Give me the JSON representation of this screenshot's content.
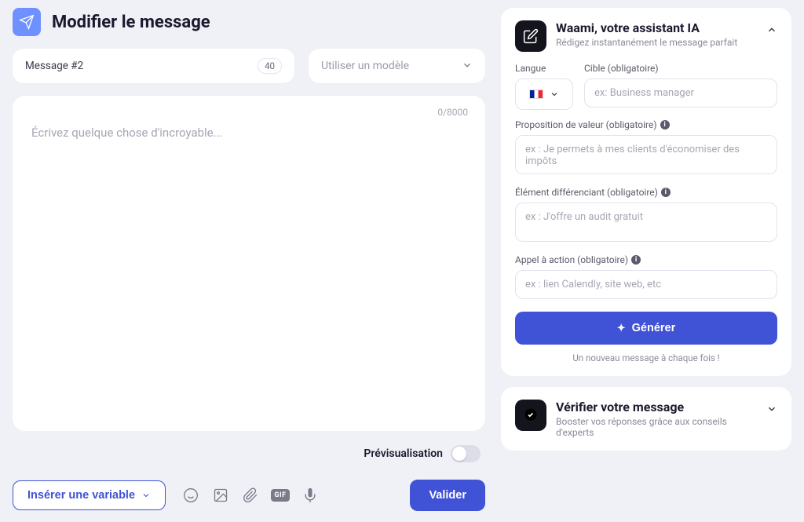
{
  "header": {
    "title": "Modifier le message"
  },
  "message": {
    "name": "Message #2",
    "name_limit": "40"
  },
  "template_select": {
    "placeholder": "Utiliser un modèle"
  },
  "editor": {
    "placeholder": "Écrivez quelque chose d'incroyable...",
    "counter": "0/8000"
  },
  "preview": {
    "label": "Prévisualisation"
  },
  "toolbar": {
    "insert_variable_label": "Insérer une variable",
    "gif_label": "GIF"
  },
  "submit": {
    "label": "Valider"
  },
  "ai_panel": {
    "title": "Waami, votre assistant IA",
    "subtitle": "Rédigez instantanément le message parfait",
    "lang_label": "Langue",
    "target_label": "Cible (obligatoire)",
    "target_placeholder": "ex: Business manager",
    "value_label": "Proposition de valeur (obligatoire)",
    "value_placeholder": "ex : Je permets à mes clients d'économiser des impôts",
    "diff_label": "Élément différenciant (obligatoire)",
    "diff_placeholder": "ex : J'offre un audit gratuit",
    "cta_label": "Appel à action (obligatoire)",
    "cta_placeholder": "ex : lien Calendly, site web, etc",
    "generate_label": "Générer",
    "footer_note": "Un nouveau message à chaque fois !"
  },
  "verify_panel": {
    "title": "Vérifier votre message",
    "subtitle": "Booster vos réponses grâce aux conseils d'experts"
  }
}
